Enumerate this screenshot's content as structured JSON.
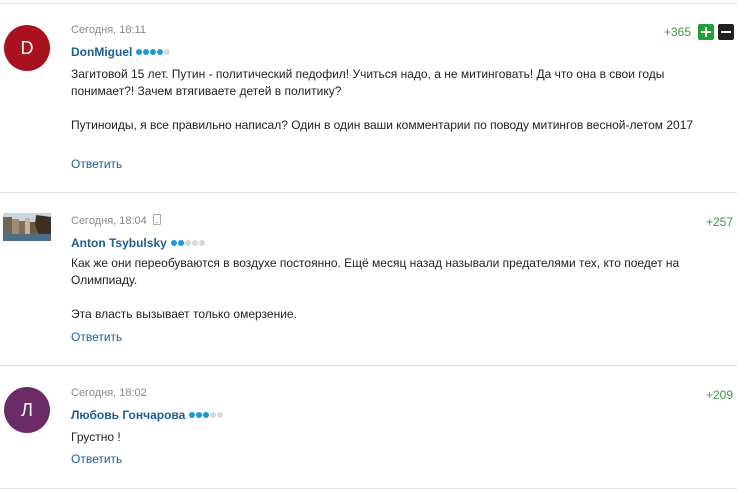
{
  "comments": [
    {
      "avatar_letter": "D",
      "avatar_color": "#a9111f",
      "timestamp": "Сегодня, 18:11",
      "author": "DonMiguel",
      "rank_filled": 4,
      "rank_total": 5,
      "score": "+365",
      "paragraphs": [
        "Загитовой 15 лет. Путин - политический педофил! Учиться надо, а не митинговать! Да что она в свои годы понимает?! Зачем втягиваете детей в политику?",
        "Путиноиды, я все правильно написал? Один в один ваши комментарии по поводу митингов весной-летом 2017"
      ],
      "reply_label": "Ответить"
    },
    {
      "avatar_photo": "canal-photo",
      "timestamp": "Сегодня, 18:04",
      "author": "Anton Tsybulsky",
      "rank_filled": 2,
      "rank_total": 5,
      "score": "+257",
      "paragraphs": [
        "Как же они переобуваются в воздухе постоянно. Ещё месяц назад называли предателями тех, кто поедет на Олимпиаду.",
        "Эта власть вызывает только омерзение."
      ],
      "reply_label": "Ответить"
    },
    {
      "avatar_letter": "Л",
      "avatar_color": "#6a2b66",
      "timestamp": "Сегодня, 18:02",
      "author": "Любовь Гончарова",
      "rank_filled": 3,
      "rank_total": 5,
      "score": "+209",
      "paragraphs": [
        "Грустно !"
      ],
      "reply_label": "Ответить"
    }
  ],
  "icons": {
    "vote_up": "plus-icon",
    "vote_down": "minus-icon",
    "mobile": "mobile-phone-icon"
  },
  "colors": {
    "link": "#1c5f94",
    "score": "#3a9a3a",
    "rank_on": "#1a9ad8",
    "rank_off": "#d8d8d8",
    "vote_up": "#21a033"
  }
}
